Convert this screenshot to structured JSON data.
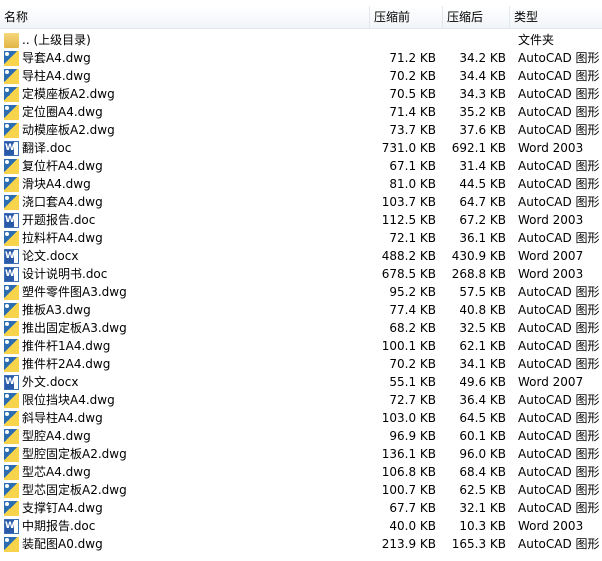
{
  "columns": {
    "name": "名称",
    "before": "压缩前",
    "after": "压缩后",
    "type": "类型"
  },
  "parent": {
    "name": ".. (上级目录)",
    "type": "文件夹"
  },
  "files": [
    {
      "name": "导套A4.dwg",
      "before": "71.2 KB",
      "after": "34.2 KB",
      "type": "AutoCAD 图形",
      "icon": "dwg"
    },
    {
      "name": "导柱A4.dwg",
      "before": "70.2 KB",
      "after": "34.4 KB",
      "type": "AutoCAD 图形",
      "icon": "dwg"
    },
    {
      "name": "定模座板A2.dwg",
      "before": "70.5 KB",
      "after": "34.3 KB",
      "type": "AutoCAD 图形",
      "icon": "dwg"
    },
    {
      "name": "定位圈A4.dwg",
      "before": "71.4 KB",
      "after": "35.2 KB",
      "type": "AutoCAD 图形",
      "icon": "dwg"
    },
    {
      "name": "动模座板A2.dwg",
      "before": "73.7 KB",
      "after": "37.6 KB",
      "type": "AutoCAD 图形",
      "icon": "dwg"
    },
    {
      "name": "翻译.doc",
      "before": "731.0 KB",
      "after": "692.1 KB",
      "type": "Word 2003",
      "icon": "doc"
    },
    {
      "name": "复位杆A4.dwg",
      "before": "67.1 KB",
      "after": "31.4 KB",
      "type": "AutoCAD 图形",
      "icon": "dwg"
    },
    {
      "name": "滑块A4.dwg",
      "before": "81.0 KB",
      "after": "44.5 KB",
      "type": "AutoCAD 图形",
      "icon": "dwg"
    },
    {
      "name": "浇口套A4.dwg",
      "before": "103.7 KB",
      "after": "64.7 KB",
      "type": "AutoCAD 图形",
      "icon": "dwg"
    },
    {
      "name": "开题报告.doc",
      "before": "112.5 KB",
      "after": "67.2 KB",
      "type": "Word 2003",
      "icon": "doc"
    },
    {
      "name": "拉料杆A4.dwg",
      "before": "72.1 KB",
      "after": "36.1 KB",
      "type": "AutoCAD 图形",
      "icon": "dwg"
    },
    {
      "name": "论文.docx",
      "before": "488.2 KB",
      "after": "430.9 KB",
      "type": "Word 2007",
      "icon": "doc"
    },
    {
      "name": "设计说明书.doc",
      "before": "678.5 KB",
      "after": "268.8 KB",
      "type": "Word 2003",
      "icon": "doc"
    },
    {
      "name": "塑件零件图A3.dwg",
      "before": "95.2 KB",
      "after": "57.5 KB",
      "type": "AutoCAD 图形",
      "icon": "dwg"
    },
    {
      "name": "推板A3.dwg",
      "before": "77.4 KB",
      "after": "40.8 KB",
      "type": "AutoCAD 图形",
      "icon": "dwg"
    },
    {
      "name": "推出固定板A3.dwg",
      "before": "68.2 KB",
      "after": "32.5 KB",
      "type": "AutoCAD 图形",
      "icon": "dwg"
    },
    {
      "name": "推件杆1A4.dwg",
      "before": "100.1 KB",
      "after": "62.1 KB",
      "type": "AutoCAD 图形",
      "icon": "dwg"
    },
    {
      "name": "推件杆2A4.dwg",
      "before": "70.2 KB",
      "after": "34.1 KB",
      "type": "AutoCAD 图形",
      "icon": "dwg"
    },
    {
      "name": "外文.docx",
      "before": "55.1 KB",
      "after": "49.6 KB",
      "type": "Word 2007",
      "icon": "doc"
    },
    {
      "name": "限位挡块A4.dwg",
      "before": "72.7 KB",
      "after": "36.4 KB",
      "type": "AutoCAD 图形",
      "icon": "dwg"
    },
    {
      "name": "斜导柱A4.dwg",
      "before": "103.0 KB",
      "after": "64.5 KB",
      "type": "AutoCAD 图形",
      "icon": "dwg"
    },
    {
      "name": "型腔A4.dwg",
      "before": "96.9 KB",
      "after": "60.1 KB",
      "type": "AutoCAD 图形",
      "icon": "dwg"
    },
    {
      "name": "型腔固定板A2.dwg",
      "before": "136.1 KB",
      "after": "96.0 KB",
      "type": "AutoCAD 图形",
      "icon": "dwg"
    },
    {
      "name": "型芯A4.dwg",
      "before": "106.8 KB",
      "after": "68.4 KB",
      "type": "AutoCAD 图形",
      "icon": "dwg"
    },
    {
      "name": "型芯固定板A2.dwg",
      "before": "100.7 KB",
      "after": "62.5 KB",
      "type": "AutoCAD 图形",
      "icon": "dwg"
    },
    {
      "name": "支撑钉A4.dwg",
      "before": "67.7 KB",
      "after": "32.1 KB",
      "type": "AutoCAD 图形",
      "icon": "dwg"
    },
    {
      "name": "中期报告.doc",
      "before": "40.0 KB",
      "after": "10.3 KB",
      "type": "Word 2003",
      "icon": "doc"
    },
    {
      "name": "装配图A0.dwg",
      "before": "213.9 KB",
      "after": "165.3 KB",
      "type": "AutoCAD 图形",
      "icon": "dwg"
    }
  ]
}
